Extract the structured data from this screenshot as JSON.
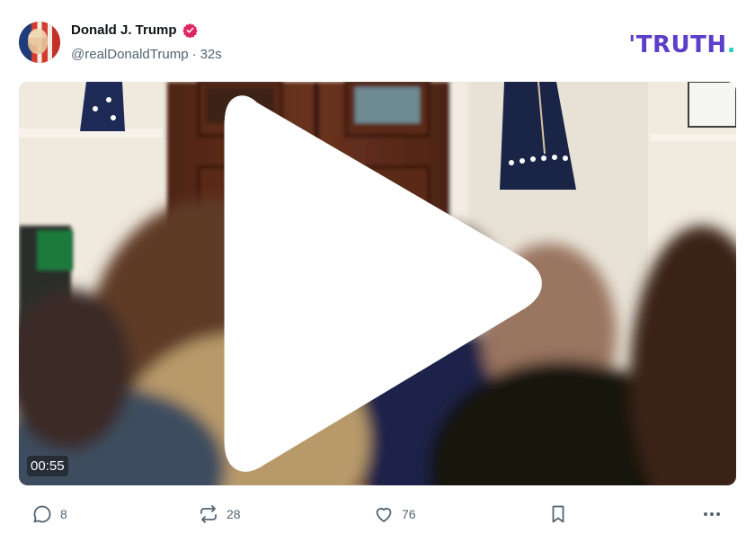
{
  "post": {
    "author_name": "Donald J. Trump",
    "handle": "@realDonaldTrump",
    "separator": "·",
    "time": "32s"
  },
  "brand": {
    "logo_text": "TRUTH",
    "logo_dot": ".",
    "accent_color": "#5c3ec8",
    "dot_color": "#25d0c2"
  },
  "video": {
    "duration": "00:55"
  },
  "actions": {
    "replies": "8",
    "retruths": "28",
    "likes": "76"
  },
  "icons": [
    "verified-badge-icon",
    "play-icon",
    "reply-icon",
    "retruth-icon",
    "heart-icon",
    "bookmark-icon",
    "more-icon"
  ]
}
